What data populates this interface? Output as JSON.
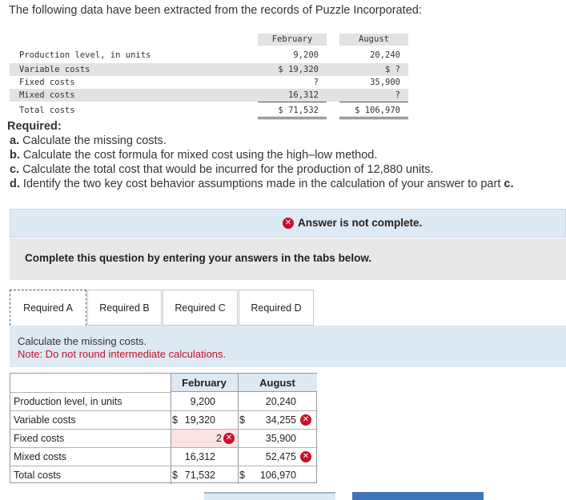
{
  "intro": "The following data have been extracted from the records of Puzzle Incorporated:",
  "data_table": {
    "headers": [
      "February",
      "August"
    ],
    "rows": [
      {
        "label": "Production level, in units",
        "feb": "9,200",
        "aug": "20,240"
      },
      {
        "label": "Variable costs",
        "feb": "$ 19,320",
        "aug": "$ ?"
      },
      {
        "label": "Fixed costs",
        "feb": "?",
        "aug": "35,900"
      },
      {
        "label": "Mixed costs",
        "feb": "16,312",
        "aug": "?"
      },
      {
        "label": "Total costs",
        "feb": "$ 71,532",
        "aug": "$ 106,970"
      }
    ]
  },
  "required": {
    "title": "Required:",
    "items": [
      {
        "letter": "a.",
        "text": "Calculate the missing costs."
      },
      {
        "letter": "b.",
        "text": "Calculate the cost formula for mixed cost using the high–low method."
      },
      {
        "letter": "c.",
        "text": "Calculate the total cost that would be incurred for the production of 12,880 units."
      },
      {
        "letter": "d.",
        "text": "Identify the two key cost behavior assumptions made in the calculation of your answer to part ",
        "bold_tail": "c."
      }
    ]
  },
  "status": {
    "message": "Answer is not complete.",
    "icon": "x-circle-icon",
    "color": "#c8102e"
  },
  "instruction": "Complete this question by entering your answers in the tabs below.",
  "tabs": [
    {
      "label": "Required A",
      "active": true
    },
    {
      "label": "Required B",
      "active": false
    },
    {
      "label": "Required C",
      "active": false
    },
    {
      "label": "Required D",
      "active": false
    }
  ],
  "content": {
    "title": "Calculate the missing costs.",
    "note": "Note: Do not round intermediate calculations."
  },
  "answer_table": {
    "headers": [
      "February",
      "August"
    ],
    "rows": [
      {
        "label": "Production level, in units",
        "feb_prefix": "",
        "feb": "9,200",
        "aug_prefix": "",
        "aug": "20,240",
        "feb_wrong": false,
        "aug_wrong": false
      },
      {
        "label": "Variable costs",
        "feb_prefix": "$",
        "feb": "19,320",
        "aug_prefix": "$",
        "aug": "34,255",
        "feb_wrong": false,
        "aug_wrong": true
      },
      {
        "label": "Fixed costs",
        "feb_prefix": "",
        "feb": "2",
        "aug_prefix": "",
        "aug": "35,900",
        "feb_wrong": true,
        "aug_wrong": false
      },
      {
        "label": "Mixed costs",
        "feb_prefix": "",
        "feb": "16,312",
        "aug_prefix": "",
        "aug": "52,475",
        "feb_wrong": false,
        "aug_wrong": true
      },
      {
        "label": "Total costs",
        "feb_prefix": "$",
        "feb": "71,532",
        "aug_prefix": "$",
        "aug": "106,970",
        "feb_wrong": false,
        "aug_wrong": false
      }
    ]
  },
  "colors": {
    "error": "#c8102e",
    "panel_blue": "#dde9f3",
    "panel_gray": "#e8e8e8",
    "button_blue": "#3e74b8"
  }
}
